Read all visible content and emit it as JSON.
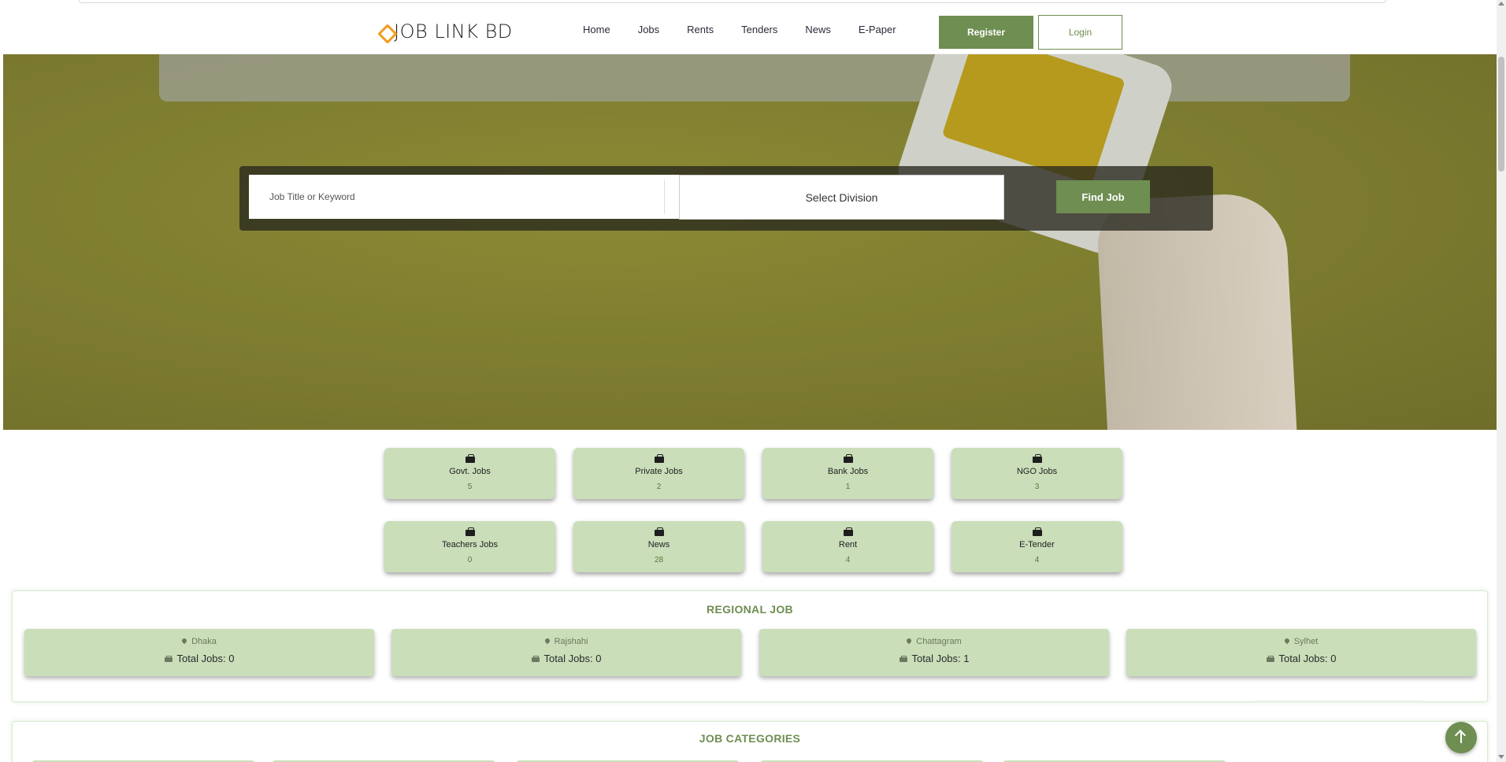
{
  "nav": {
    "brand": "JOB LINK BD",
    "links": [
      "Home",
      "Jobs",
      "Rents",
      "Tenders",
      "News",
      "E-Paper"
    ],
    "register_label": "Register",
    "login_label": "Login"
  },
  "search": {
    "keyword_placeholder": "Job Title or Keyword",
    "division_label": "Select Division",
    "find_label": "Find Job"
  },
  "categories": [
    {
      "label": "Govt. Jobs",
      "count": "5"
    },
    {
      "label": "Private Jobs",
      "count": "2"
    },
    {
      "label": "Bank Jobs",
      "count": "1"
    },
    {
      "label": "NGO Jobs",
      "count": "3"
    },
    {
      "label": "Teachers Jobs",
      "count": "0"
    },
    {
      "label": "News",
      "count": "28"
    },
    {
      "label": "Rent",
      "count": "4"
    },
    {
      "label": "E-Tender",
      "count": "4"
    }
  ],
  "regional": {
    "title": "REGIONAL JOB",
    "regions": [
      {
        "name": "Dhaka",
        "total": "Total Jobs: 0"
      },
      {
        "name": "Rajshahi",
        "total": "Total Jobs: 0"
      },
      {
        "name": "Chattagram",
        "total": "Total Jobs: 1"
      },
      {
        "name": "Sylhet",
        "total": "Total Jobs: 0"
      }
    ]
  },
  "job_categories": {
    "title": "JOB CATEGORIES"
  },
  "colors": {
    "accent": "#6f8e52",
    "card_bg": "#c9deb9",
    "hero_bg": "#7f7e30",
    "brand_mark": "#f39c1f"
  }
}
